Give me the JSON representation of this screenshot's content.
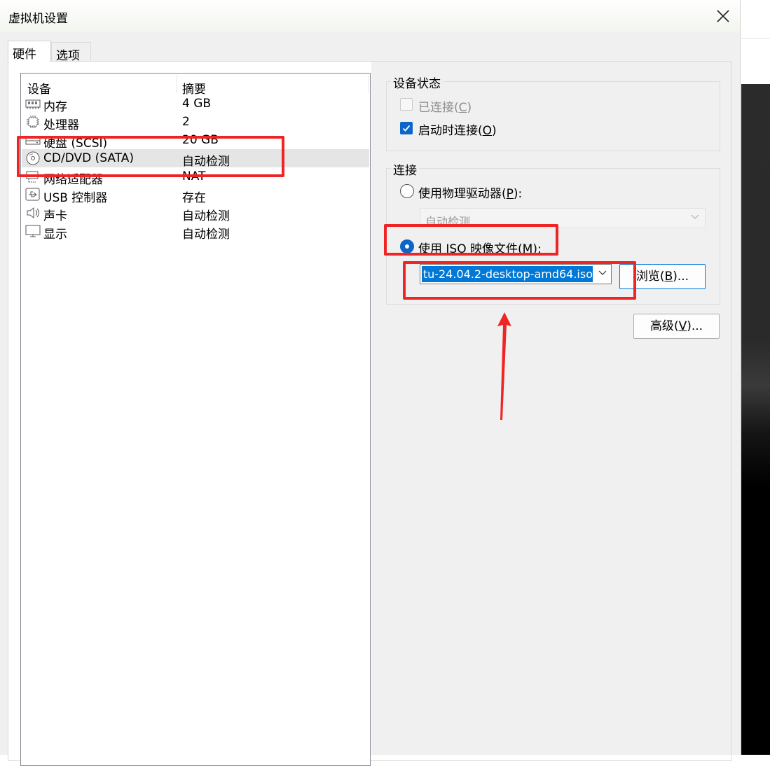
{
  "window": {
    "title": "虚拟机设置"
  },
  "tabs": [
    {
      "label": "硬件"
    },
    {
      "label": "选项"
    }
  ],
  "device_list": {
    "headers": {
      "device": "设备",
      "summary": "摘要"
    },
    "rows": [
      {
        "name": "内存",
        "summary": "4 GB",
        "icon": "memory-icon"
      },
      {
        "name": "处理器",
        "summary": "2",
        "icon": "cpu-icon"
      },
      {
        "name": "硬盘 (SCSI)",
        "summary": "20 GB",
        "icon": "hard-disk-icon"
      },
      {
        "name": "CD/DVD (SATA)",
        "summary": "自动检测",
        "icon": "cd-dvd-icon",
        "selected": true
      },
      {
        "name": "网络适配器",
        "summary": "NAT",
        "icon": "network-adapter-icon"
      },
      {
        "name": "USB 控制器",
        "summary": "存在",
        "icon": "usb-icon"
      },
      {
        "name": "声卡",
        "summary": "自动检测",
        "icon": "speaker-icon"
      },
      {
        "name": "显示",
        "summary": "自动检测",
        "icon": "monitor-icon"
      }
    ]
  },
  "device_status": {
    "label": "设备状态",
    "connected": {
      "label": "已连接",
      "key": "C",
      "checked": false,
      "disabled": true
    },
    "connect_at_power_on": {
      "label": "启动时连接",
      "key": "O",
      "checked": true
    }
  },
  "connection": {
    "label": "连接",
    "physical_drive": {
      "label": "使用物理驱动器",
      "key": "P",
      "selected": false,
      "value": "自动检测"
    },
    "iso_image": {
      "label": "使用 ISO 映像文件",
      "key": "M",
      "selected": true,
      "value": "tu-24.04.2-desktop-amd64.iso"
    },
    "browse_button": {
      "label": "浏览",
      "key": "B"
    }
  },
  "advanced_button": {
    "label": "高级",
    "key": "V"
  },
  "colors": {
    "accent": "#0b66c7",
    "selection": "#0078d7",
    "annotation": "#ef2424"
  }
}
